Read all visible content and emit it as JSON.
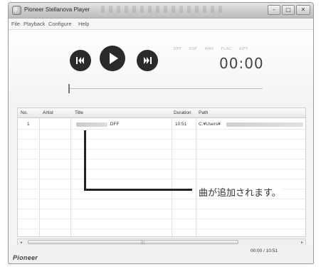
{
  "window": {
    "title": "Pioneer Stellanova Player",
    "buttons": {
      "minimize": "–",
      "maximize": "□",
      "close": "✕"
    }
  },
  "menu": {
    "items": [
      "File",
      "Playback",
      "Configure",
      "Help"
    ]
  },
  "player": {
    "formats": [
      "DFF",
      "DSF",
      "WAV",
      "FLAC",
      "AIFF"
    ],
    "time": "00:00",
    "controls": {
      "prev": "skip-previous-icon",
      "play": "play-icon",
      "next": "skip-next-icon"
    }
  },
  "playlist": {
    "columns": [
      "No.",
      "Artist",
      "Title",
      "Duration",
      "Path"
    ],
    "rows": [
      {
        "no": "1",
        "artist": "",
        "title": ".DFF",
        "duration": "10:51",
        "path": "C:¥Users¥"
      }
    ]
  },
  "annotation": {
    "text": "曲が追加されます。"
  },
  "status": {
    "time": "00:00 / 10:51",
    "brand": "Pioneer"
  }
}
